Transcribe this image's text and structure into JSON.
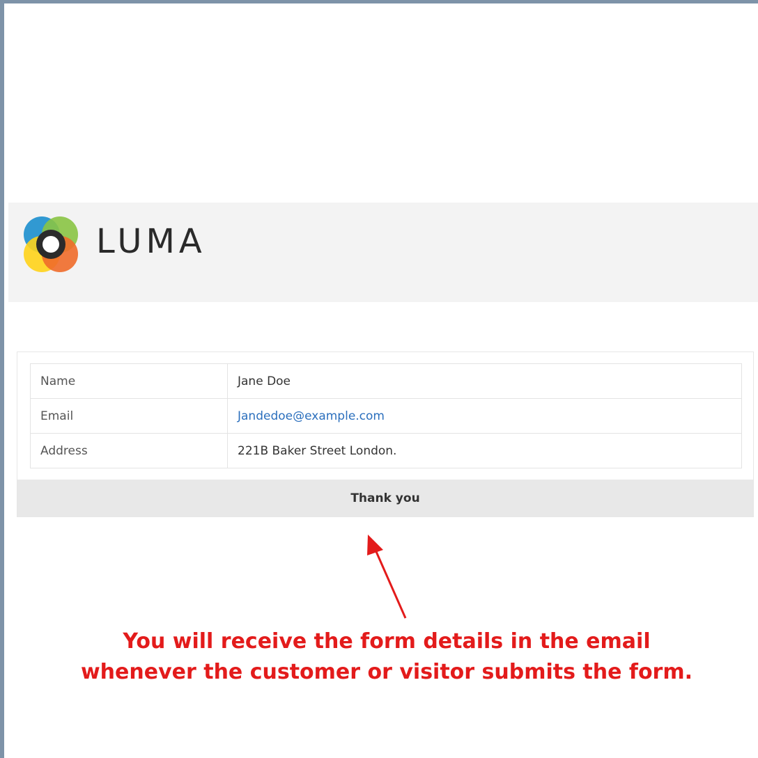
{
  "brand": {
    "name": "LUMA",
    "logo_colors": {
      "blue": "#1c8fce",
      "green": "#8ac444",
      "yellow": "#ffd31a",
      "orange": "#f06b2a",
      "center": "#2b2b2b"
    }
  },
  "details": [
    {
      "label": "Name",
      "value": "Jane Doe"
    },
    {
      "label": "Email",
      "value": "Jandedoe@example.com"
    },
    {
      "label": "Address",
      "value": "221B Baker Street London."
    }
  ],
  "footer": {
    "thanks": "Thank you"
  },
  "annotation": {
    "line1": "You will receive the form details in the email",
    "line2": "whenever the customer or visitor submits the form.",
    "color": "#e31b1b"
  }
}
